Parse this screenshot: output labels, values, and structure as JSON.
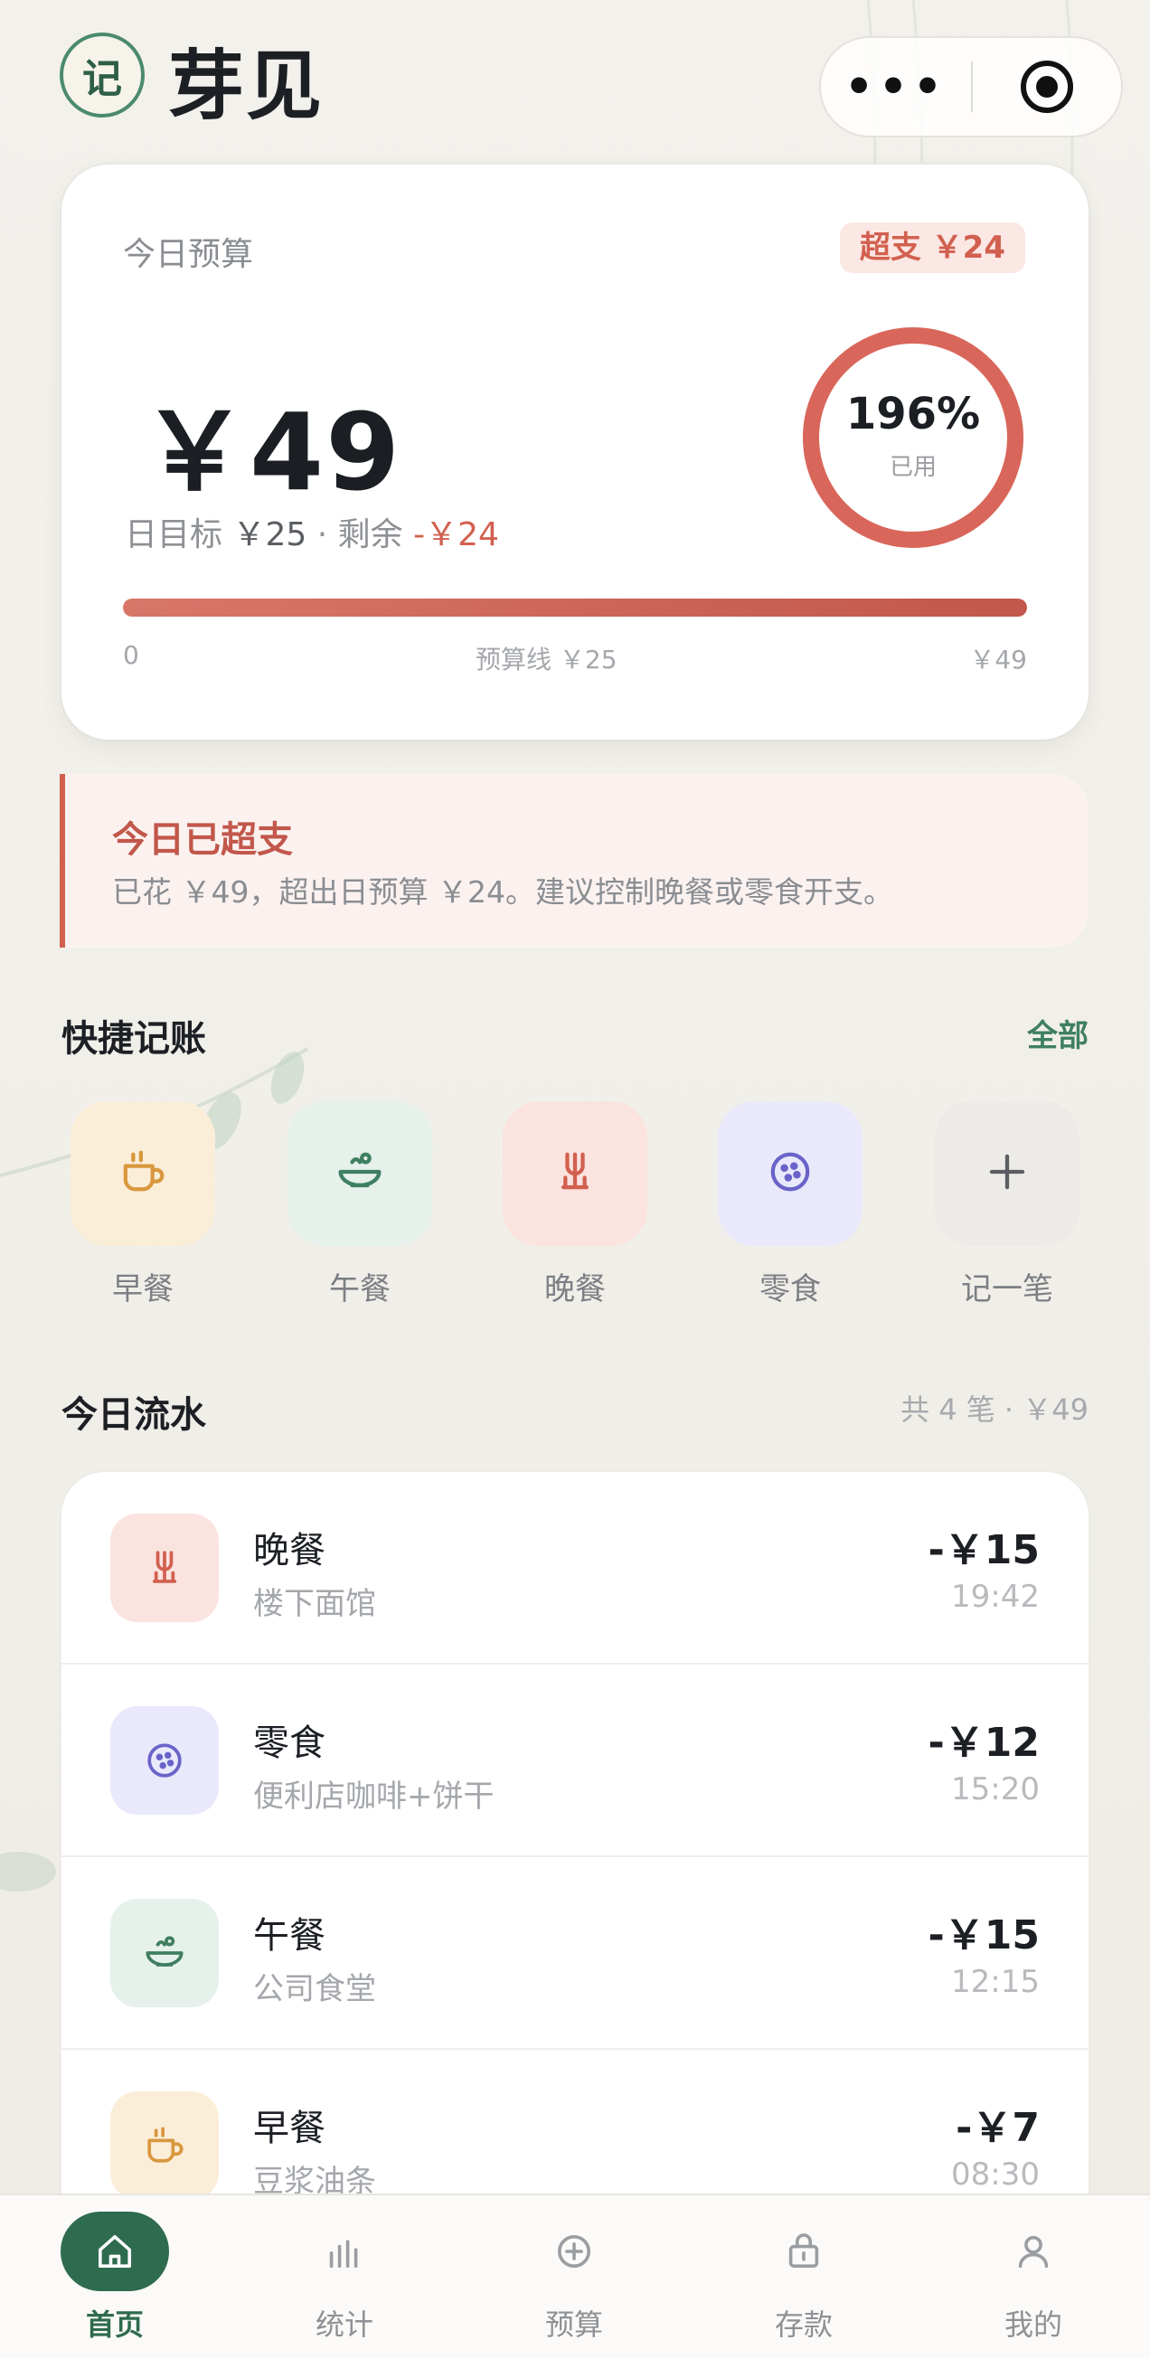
{
  "header": {
    "app_name": "芽见",
    "logo_char": "记",
    "capsule_more": "•••"
  },
  "budget": {
    "label": "今日预算",
    "over_badge": "超支 ￥24",
    "amount": "￥49",
    "target_label": "日目标",
    "target_value": "￥25",
    "separator": "·",
    "remain_label": "剩余",
    "remain_value": "-￥24",
    "percent_text": "196%",
    "percent_value": 196,
    "used_label": "已用",
    "progress_fraction": 1.0,
    "bar_start": "0",
    "bar_mid": "预算线 ￥25",
    "bar_end": "￥49"
  },
  "alert": {
    "title": "今日已超支",
    "body": "已花 ￥49，超出日预算 ￥24。建议控制晚餐或零食开支。"
  },
  "quick": {
    "title": "快捷记账",
    "all_link": "全部",
    "items": [
      {
        "label": "早餐",
        "icon": "coffee-cup-icon",
        "bg": "#fbeed9",
        "color": "#d9983f"
      },
      {
        "label": "午餐",
        "icon": "bowl-icon",
        "bg": "#e5f1ea",
        "color": "#3f7f61"
      },
      {
        "label": "晚餐",
        "icon": "dinner-icon",
        "bg": "#fbe3df",
        "color": "#d2604f"
      },
      {
        "label": "零食",
        "icon": "cookie-icon",
        "bg": "#e9e9fb",
        "color": "#6a63c9"
      },
      {
        "label": "记一笔",
        "icon": "plus-icon",
        "bg": "#ecebe7",
        "color": "#5a5d62"
      }
    ]
  },
  "flow": {
    "title": "今日流水",
    "meta": "共 4 笔 · ￥49",
    "rows": [
      {
        "title": "晚餐",
        "sub": "楼下面馆",
        "amount": "-￥15",
        "time": "19:42",
        "icon": "dinner-icon",
        "bg": "#fbe3df",
        "color": "#d2604f"
      },
      {
        "title": "零食",
        "sub": "便利店咖啡+饼干",
        "amount": "-￥12",
        "time": "15:20",
        "icon": "cookie-icon",
        "bg": "#e9e9fb",
        "color": "#6a63c9"
      },
      {
        "title": "午餐",
        "sub": "公司食堂",
        "amount": "-￥15",
        "time": "12:15",
        "icon": "bowl-icon",
        "bg": "#e5f1ea",
        "color": "#3f7f61"
      },
      {
        "title": "早餐",
        "sub": "豆浆油条",
        "amount": "-￥7",
        "time": "08:30",
        "icon": "coffee-cup-icon",
        "bg": "#fbeed9",
        "color": "#d9983f"
      }
    ]
  },
  "tabs": [
    {
      "label": "首页",
      "icon": "home-icon",
      "active": true
    },
    {
      "label": "统计",
      "icon": "bar-chart-icon",
      "active": false
    },
    {
      "label": "预算",
      "icon": "plus-circle-icon",
      "active": false
    },
    {
      "label": "存款",
      "icon": "lock-bag-icon",
      "active": false
    },
    {
      "label": "我的",
      "icon": "user-icon",
      "active": false
    }
  ],
  "colors": {
    "accent": "#2f6b4e",
    "danger": "#d2604f"
  }
}
